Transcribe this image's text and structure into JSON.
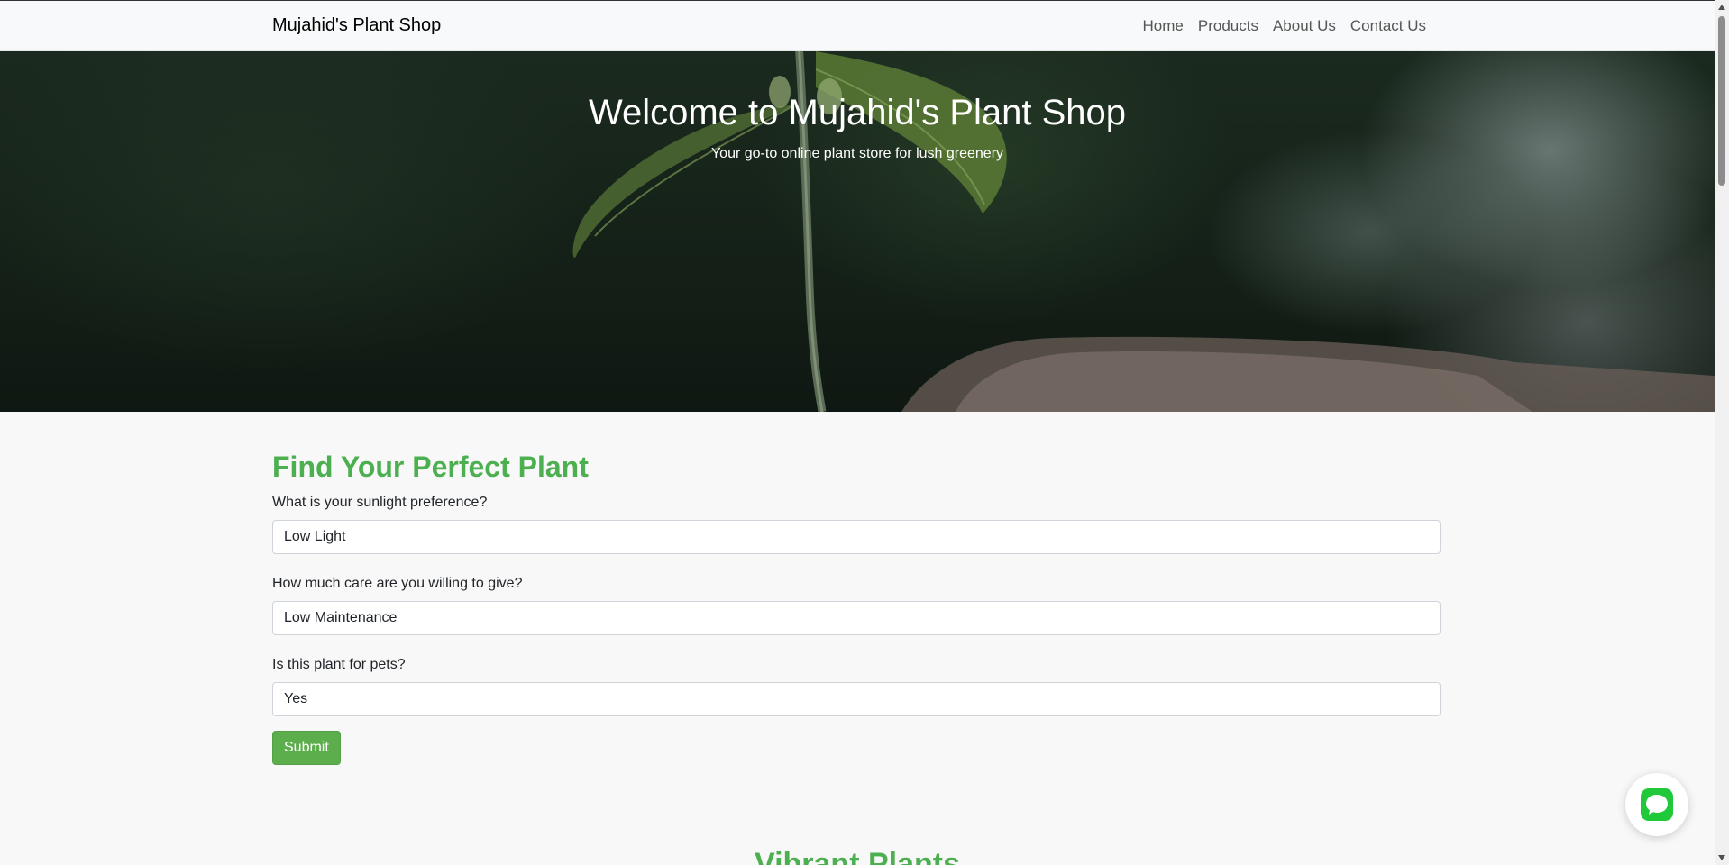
{
  "navbar": {
    "brand": "Mujahid's Plant Shop",
    "links": [
      {
        "label": "Home"
      },
      {
        "label": "Products"
      },
      {
        "label": "About Us"
      },
      {
        "label": "Contact Us"
      }
    ]
  },
  "hero": {
    "title": "Welcome to Mujahid's Plant Shop",
    "subtitle": "Your go-to online plant store for lush greenery"
  },
  "finder": {
    "heading": "Find Your Perfect Plant",
    "questions": [
      {
        "label": "What is your sunlight preference?",
        "value": "Low Light"
      },
      {
        "label": "How much care are you willing to give?",
        "value": "Low Maintenance"
      },
      {
        "label": "Is this plant for pets?",
        "value": "Yes"
      }
    ],
    "submit_label": "Submit"
  },
  "next_section": {
    "heading": "Vibrant Plants"
  },
  "chat": {
    "icon": "chat-bubble-icon"
  },
  "colors": {
    "accent_green": "#4caf50",
    "button_green": "#5cae4d",
    "chat_green": "#1fc93a"
  }
}
